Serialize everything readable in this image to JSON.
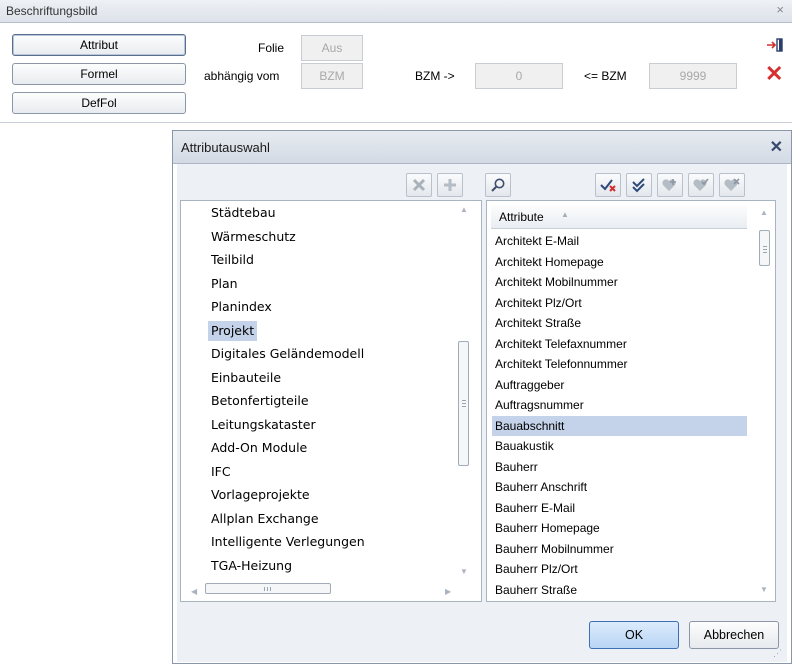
{
  "panel": {
    "title": "Beschriftungsbild",
    "close_glyph": "×",
    "buttons": [
      "Attribut",
      "Formel",
      "DefFol"
    ],
    "folie_label": "Folie",
    "folie_value": "Aus",
    "abhaengig_label": "abhängig vom",
    "abhaengig_value": "BZM",
    "bzm_from_label": "BZM ->",
    "bzm_from_value": "0",
    "bzm_to_label": "<= BZM",
    "bzm_to_value": "9999",
    "icons": [
      "exit-icon",
      "close-x-icon"
    ]
  },
  "dialog": {
    "title": "Attributauswahl",
    "close_glyph": "✕",
    "toolbar_left_icons": [
      "delete-icon",
      "add-icon",
      "search-icon"
    ],
    "toolbar_right_icons": [
      "uncheck-all-icon",
      "check-all-icon",
      "heart-add-icon",
      "heart-check-icon",
      "heart-remove-icon"
    ],
    "categories": [
      "Städtebau",
      "Wärmeschutz",
      "Teilbild",
      "Plan",
      "Planindex",
      "Projekt",
      "Digitales Geländemodell",
      "Einbauteile",
      "Betonfertigteile",
      "Leitungskataster",
      "Add-On Module",
      "IFC",
      "Vorlageprojekte",
      "Allplan Exchange",
      "Intelligente Verlegungen",
      "TGA-Heizung"
    ],
    "selected_category": "Projekt",
    "attributes_header": "Attribute",
    "attributes": [
      "Architekt E-Mail",
      "Architekt Homepage",
      "Architekt Mobilnummer",
      "Architekt Plz/Ort",
      "Architekt Straße",
      "Architekt Telefaxnummer",
      "Architekt Telefonnummer",
      "Auftraggeber",
      "Auftragsnummer",
      "Bauabschnitt",
      "Bauakustik",
      "Bauherr",
      "Bauherr Anschrift",
      "Bauherr E-Mail",
      "Bauherr Homepage",
      "Bauherr Mobilnummer",
      "Bauherr Plz/Ort",
      "Bauherr Straße"
    ],
    "selected_attribute": "Bauabschnitt",
    "ok_label": "OK",
    "cancel_label": "Abbrechen"
  }
}
